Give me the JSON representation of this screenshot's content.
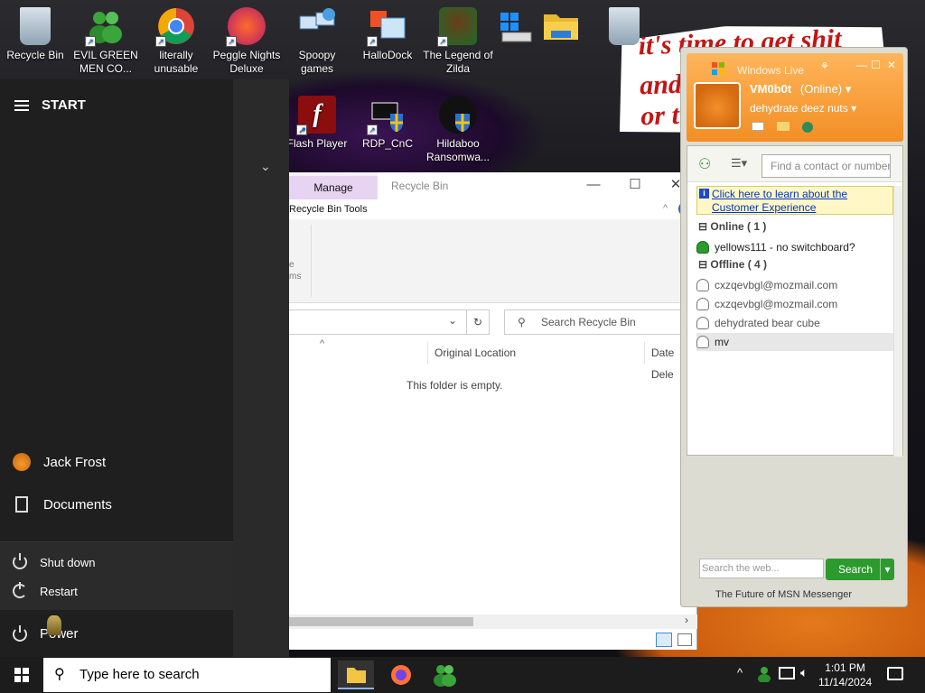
{
  "wallpaper": {
    "banner_lines": [
      "it's time to get shit",
      "and",
      "or t"
    ]
  },
  "desktop": {
    "icons": [
      {
        "label": "Recycle Bin",
        "icon": "recycle-bin-icon",
        "shortcut": false
      },
      {
        "label": "EVIL GREEN MEN CO...",
        "icon": "msn-buddies-icon",
        "shortcut": true
      },
      {
        "label": "literally unusable",
        "icon": "chrome-icon",
        "shortcut": true
      },
      {
        "label": "Peggle Nights Deluxe",
        "icon": "peggle-icon",
        "shortcut": true
      },
      {
        "label": "Spoopy games",
        "icon": "network-computers-icon",
        "shortcut": false
      },
      {
        "label": "HalloDock",
        "icon": "dock-app-icon",
        "shortcut": true
      },
      {
        "label": "The Legend of Zilda",
        "icon": "zilda-game-icon",
        "shortcut": true
      },
      {
        "label": "",
        "icon": "windows-drive-icon",
        "shortcut": false
      },
      {
        "label": "",
        "icon": "folder-icon",
        "shortcut": false
      },
      {
        "label": "",
        "icon": "recycle-bin-icon",
        "shortcut": false
      },
      {
        "label": "Flash Player",
        "icon": "flash-player-icon",
        "shortcut": true
      },
      {
        "label": "RDP_CnC",
        "icon": "rdp-shield-icon",
        "shortcut": true
      },
      {
        "label": "Hildaboo Ransomwa...",
        "icon": "yashma-shield-icon",
        "shortcut": false
      }
    ]
  },
  "start_menu": {
    "title": "START",
    "user_name": "Jack Frost",
    "documents_label": "Documents",
    "power_options": [
      "Shut down",
      "Restart"
    ],
    "power_label": "Power"
  },
  "explorer": {
    "tab_manage": "Manage",
    "window_title": "Recycle Bin",
    "ribbon_tab": "Recycle Bin Tools",
    "ribbon_partial_labels": [
      "e",
      "ms"
    ],
    "search_placeholder": "Search Recycle Bin",
    "columns": [
      "Original Location",
      "Date Dele"
    ],
    "empty_message": "This folder is empty.",
    "minimize": "—",
    "maximize": "☐",
    "close": "✕",
    "help": "?"
  },
  "msn": {
    "window_title": "Windows Live",
    "display_name": "VM0b0t",
    "status": "(Online)",
    "personal_message": "dehydrate deez nuts",
    "find_placeholder": "Find a contact or number",
    "banner_text": "Click here to learn about the Customer Experience",
    "groups": [
      {
        "name": "Online ( 1 )",
        "contacts": [
          {
            "name": "yellows111 - no switchboard?",
            "online": true
          }
        ]
      },
      {
        "name": "Offline ( 4 )",
        "contacts": [
          {
            "name": "cxzqevbgl@mozmail.com",
            "online": false
          },
          {
            "name": "cxzqevbgl@mozmail.com",
            "online": false
          },
          {
            "name": "dehydrated bear cube",
            "online": false
          },
          {
            "name": "mv",
            "online": false
          }
        ]
      }
    ],
    "web_search_placeholder": "Search the web...",
    "search_button": "Search",
    "footer": "The Future of MSN Messenger"
  },
  "taskbar": {
    "search_placeholder": "Type here to search",
    "apps": [
      "file-explorer-icon",
      "firefox-icon",
      "msn-messenger-icon"
    ],
    "time": "1:01 PM",
    "date": "11/14/2024"
  },
  "colors": {
    "msn_orange": "#f38e25",
    "msn_green": "#2d9a2d",
    "start_bg": "#1f1f1f",
    "manage_tab": "#e7d3f2",
    "link_blue": "#0033cc"
  }
}
